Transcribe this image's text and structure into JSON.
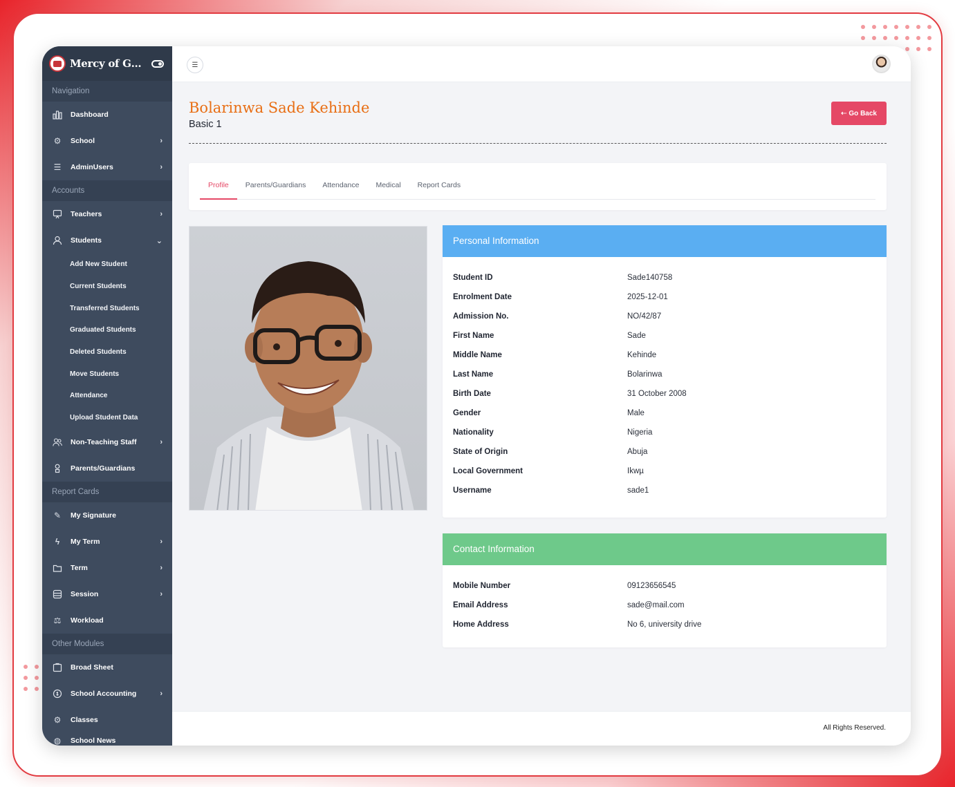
{
  "app": {
    "brand_name": "Mercy of God Sch..."
  },
  "sidebar": {
    "sections": {
      "navigation": "Navigation",
      "accounts": "Accounts",
      "report_cards": "Report Cards",
      "other_modules": "Other Modules"
    },
    "items": {
      "dashboard": "Dashboard",
      "school": "School",
      "admin_users": "AdminUsers",
      "teachers": "Teachers",
      "students": "Students",
      "non_teaching_staff": "Non-Teaching Staff",
      "parents_guardians": "Parents/Guardians",
      "my_signature": "My Signature",
      "my_term": "My Term",
      "term": "Term",
      "session": "Session",
      "workload": "Workload",
      "broad_sheet": "Broad Sheet",
      "school_accounting": "School Accounting",
      "classes": "Classes",
      "school_news": "School News"
    },
    "students_sub": [
      "Add New Student",
      "Current Students",
      "Transferred Students",
      "Graduated Students",
      "Deleted Students",
      "Move Students",
      "Attendance",
      "Upload Student Data"
    ]
  },
  "header": {
    "student_name": "Bolarinwa Sade Kehinde",
    "student_class": "Basic 1",
    "go_back_label": "Go Back",
    "go_back_icon": "arrow-left-icon"
  },
  "tabs": [
    "Profile",
    "Parents/Guardians",
    "Attendance",
    "Medical",
    "Report Cards"
  ],
  "personal": {
    "title": "Personal Information",
    "color": "#5aaef2",
    "rows": [
      {
        "label": "Student ID",
        "value": "Sade140758"
      },
      {
        "label": "Enrolment Date",
        "value": "2025-12-01"
      },
      {
        "label": "Admission No.",
        "value": "NO/42/87"
      },
      {
        "label": "First Name",
        "value": "Sade"
      },
      {
        "label": "Middle Name",
        "value": "Kehinde"
      },
      {
        "label": "Last Name",
        "value": "Bolarinwa"
      },
      {
        "label": "Birth Date",
        "value": "31 October 2008"
      },
      {
        "label": "Gender",
        "value": "Male"
      },
      {
        "label": "Nationality",
        "value": "Nigeria"
      },
      {
        "label": "State of Origin",
        "value": "Abuja"
      },
      {
        "label": "Local Government",
        "value": "Ikwµ"
      },
      {
        "label": "Username",
        "value": "sade1"
      }
    ]
  },
  "contact": {
    "title": "Contact Information",
    "color": "#6ec98a",
    "rows": [
      {
        "label": "Mobile Number",
        "value": "09123656545"
      },
      {
        "label": "Email Address",
        "value": "sade@mail.com"
      },
      {
        "label": "Home Address",
        "value": "No 6, university drive"
      }
    ]
  },
  "footer": {
    "text": "All Rights Reserved."
  },
  "colors": {
    "accent": "#e54866",
    "name_orange": "#e86e14",
    "sidebar_bg": "#3e4b5e"
  }
}
